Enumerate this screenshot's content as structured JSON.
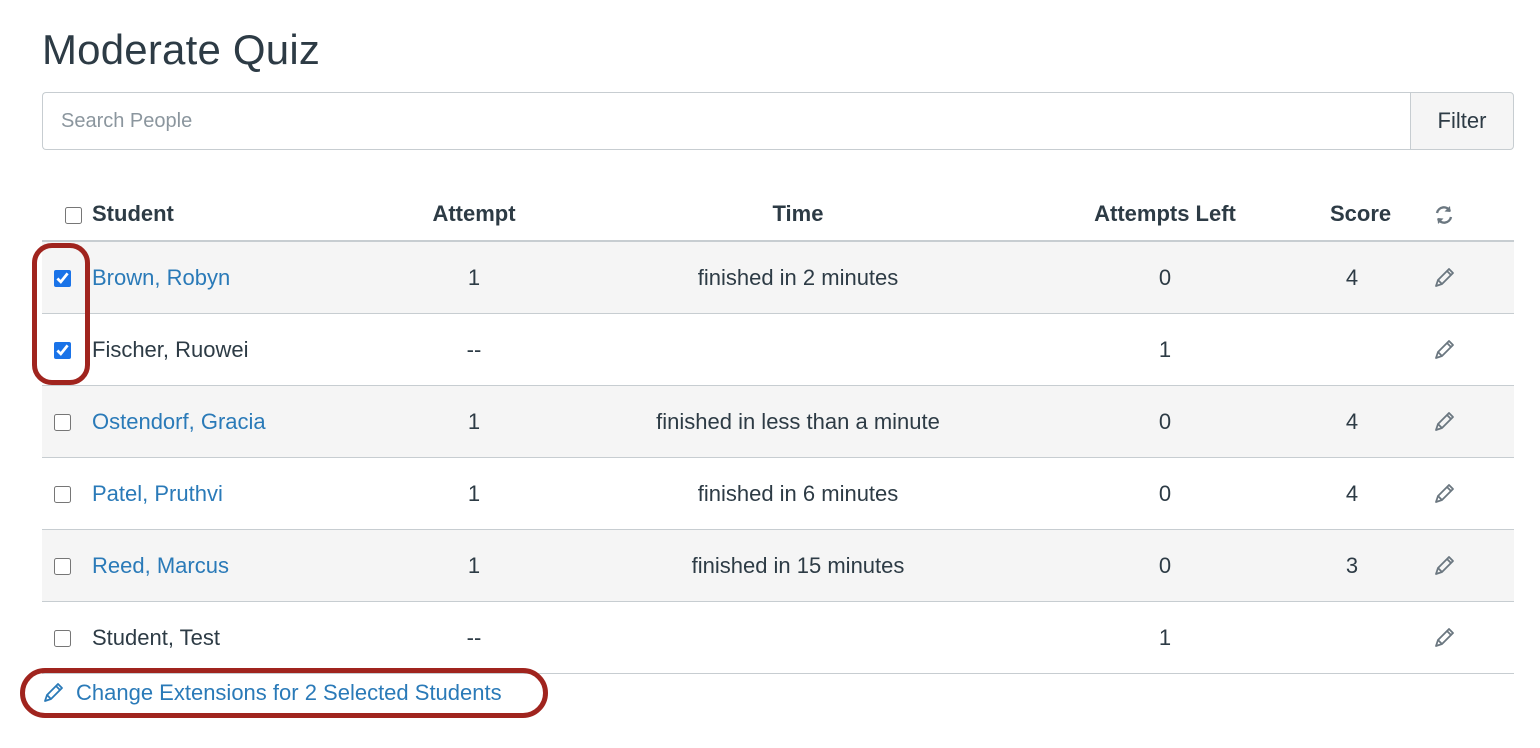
{
  "page": {
    "title": "Moderate Quiz"
  },
  "search": {
    "placeholder": "Search People",
    "value": "",
    "filter_label": "Filter"
  },
  "table": {
    "headers": {
      "student": "Student",
      "attempt": "Attempt",
      "time": "Time",
      "attempts_left": "Attempts Left",
      "score": "Score"
    },
    "header_action_icon": "refresh-icon",
    "row_action_icon": "pencil-icon",
    "rows": [
      {
        "checked": true,
        "student": "Brown, Robyn",
        "is_link": true,
        "attempt": "1",
        "time": "finished in 2 minutes",
        "attempts_left": "0",
        "score": "4"
      },
      {
        "checked": true,
        "student": "Fischer, Ruowei",
        "is_link": false,
        "attempt": "--",
        "time": "",
        "attempts_left": "1",
        "score": ""
      },
      {
        "checked": false,
        "student": "Ostendorf, Gracia",
        "is_link": true,
        "attempt": "1",
        "time": "finished in less than a minute",
        "attempts_left": "0",
        "score": "4"
      },
      {
        "checked": false,
        "student": "Patel, Pruthvi",
        "is_link": true,
        "attempt": "1",
        "time": "finished in 6 minutes",
        "attempts_left": "0",
        "score": "4"
      },
      {
        "checked": false,
        "student": "Reed, Marcus",
        "is_link": true,
        "attempt": "1",
        "time": "finished in 15 minutes",
        "attempts_left": "0",
        "score": "3"
      },
      {
        "checked": false,
        "student": "Student, Test",
        "is_link": false,
        "attempt": "--",
        "time": "",
        "attempts_left": "1",
        "score": ""
      }
    ]
  },
  "footer": {
    "change_extensions_label": "Change Extensions for 2 Selected Students",
    "icon": "pencil-icon"
  },
  "colors": {
    "link": "#2a7ab8",
    "text": "#2d3b45",
    "highlight": "#a0241e",
    "row_stripe": "#f5f5f5",
    "border": "#c7cdd1"
  }
}
